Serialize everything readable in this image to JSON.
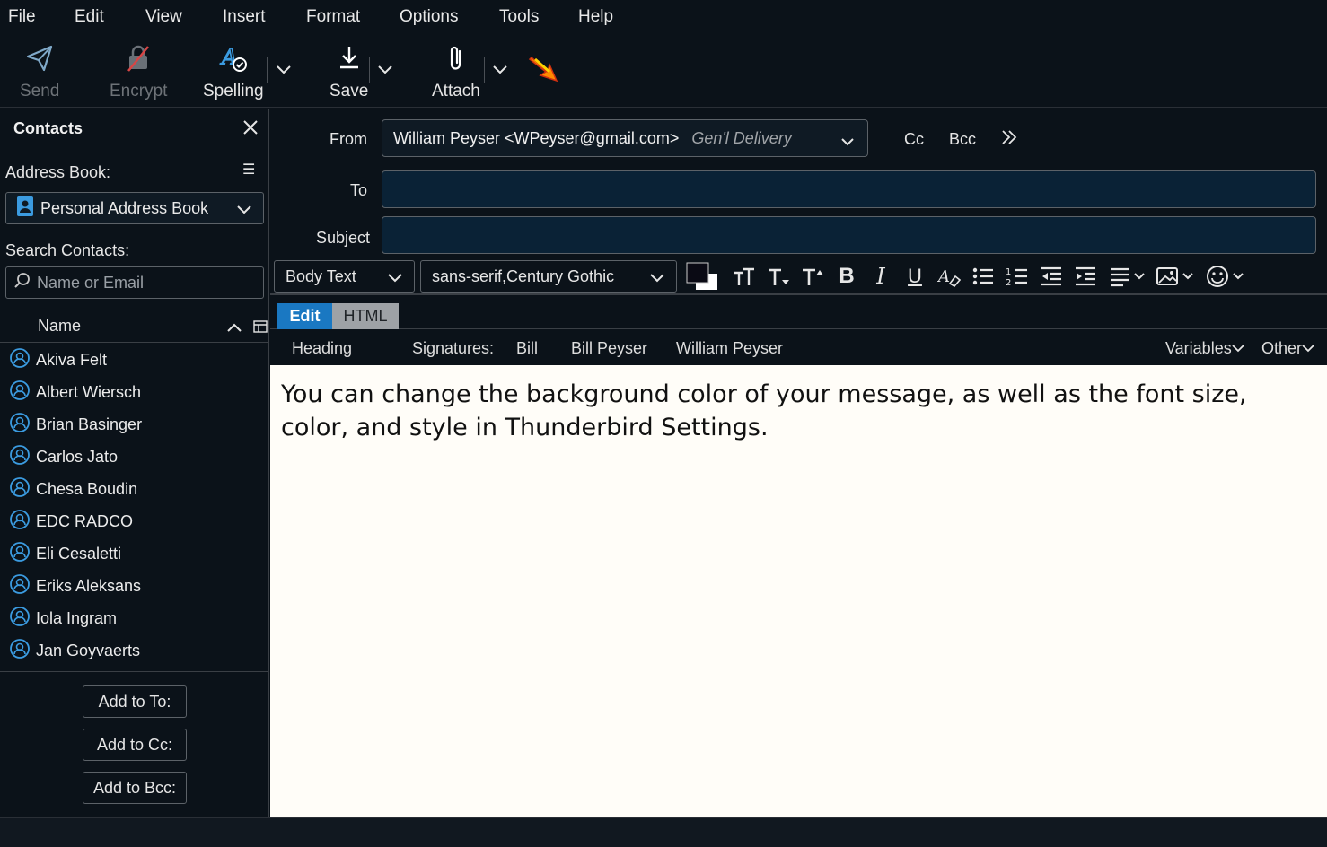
{
  "menu": {
    "items": [
      "File",
      "Edit",
      "View",
      "Insert",
      "Format",
      "Options",
      "Tools",
      "Help"
    ],
    "underline_letters": [
      "F",
      "E",
      "V",
      "I",
      "o",
      "O",
      "T",
      "H"
    ]
  },
  "toolbar": {
    "send_label": "Send",
    "encrypt_label": "Encrypt",
    "spelling_label": "Spelling",
    "save_label": "Save",
    "attach_label": "Attach"
  },
  "sidebar": {
    "title": "Contacts",
    "address_book_label": "Address Book:",
    "address_book_value": "Personal Address Book",
    "search_label": "Search Contacts:",
    "search_placeholder": "Name or Email",
    "column_header": "Name",
    "contacts": [
      "Akiva Felt",
      "Albert Wiersch",
      "Brian Basinger",
      "Carlos Jato",
      "Chesa Boudin",
      "EDC RADCO",
      "Eli Cesaletti",
      "Eriks Aleksans",
      "Iola Ingram",
      "Jan Goyvaerts"
    ],
    "add_to": "Add to To:",
    "add_cc": "Add to Cc:",
    "add_bcc": "Add to Bcc:"
  },
  "header": {
    "from_label": "From",
    "from_address": "William Peyser <WPeyser@gmail.com>",
    "from_identity": "Gen'l Delivery",
    "cc_label": "Cc",
    "bcc_label": "Bcc",
    "to_label": "To",
    "subject_label": "Subject",
    "to_value": "",
    "subject_value": ""
  },
  "format": {
    "paragraph_style": "Body Text",
    "font": "sans-serif,Century Gothic"
  },
  "tabs": {
    "edit": "Edit",
    "html": "HTML"
  },
  "sigbar": {
    "heading": "Heading",
    "signatures_label": "Signatures:",
    "sig1": "Bill",
    "sig2": "Bill Peyser",
    "sig3": "William Peyser",
    "variables": "Variables",
    "other": "Other"
  },
  "body": {
    "text": "You can change the background color of your message, as well as the font size, color, and style in Thunderbird Settings."
  },
  "colors": {
    "background": "#0b1219",
    "accent": "#1a78c2",
    "input_bg": "#0a2236",
    "body_bg": "#fffdf8",
    "contact_icon": "#3b9be0"
  }
}
